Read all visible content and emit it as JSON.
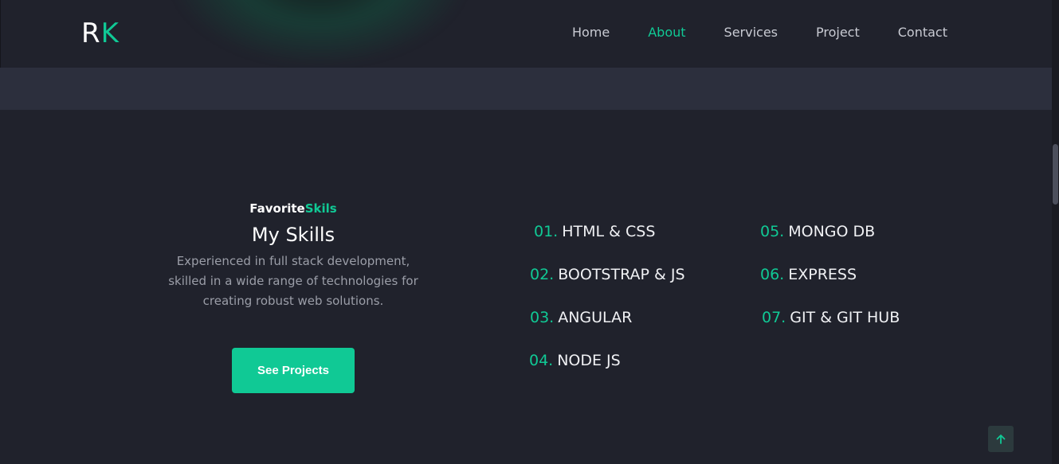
{
  "header": {
    "logo": {
      "first": "R",
      "second": "K"
    },
    "nav": [
      {
        "label": "Home",
        "active": false
      },
      {
        "label": "About",
        "active": true
      },
      {
        "label": "Services",
        "active": false
      },
      {
        "label": "Project",
        "active": false
      },
      {
        "label": "Contact",
        "active": false
      }
    ]
  },
  "about": {
    "subtitle_white": "Favorite",
    "subtitle_green": "Skils",
    "title": "My Skills",
    "description": "Experienced in full stack development, skilled in a wide range of technologies for creating robust web solutions.",
    "button_label": "See Projects"
  },
  "skills": [
    {
      "num": "01.",
      "name": "HTML & CSS"
    },
    {
      "num": "02.",
      "name": "BOOTSTRAP & JS"
    },
    {
      "num": "03.",
      "name": "ANGULAR"
    },
    {
      "num": "04.",
      "name": "NODE JS"
    },
    {
      "num": "05.",
      "name": "MONGO DB"
    },
    {
      "num": "06.",
      "name": "EXPRESS"
    },
    {
      "num": "07.",
      "name": "GIT & GIT HUB"
    }
  ],
  "icons": {
    "scroll_top": "arrow-up-icon"
  },
  "colors": {
    "accent": "#10c995",
    "background": "#20222c",
    "band": "#2c2f3d"
  }
}
